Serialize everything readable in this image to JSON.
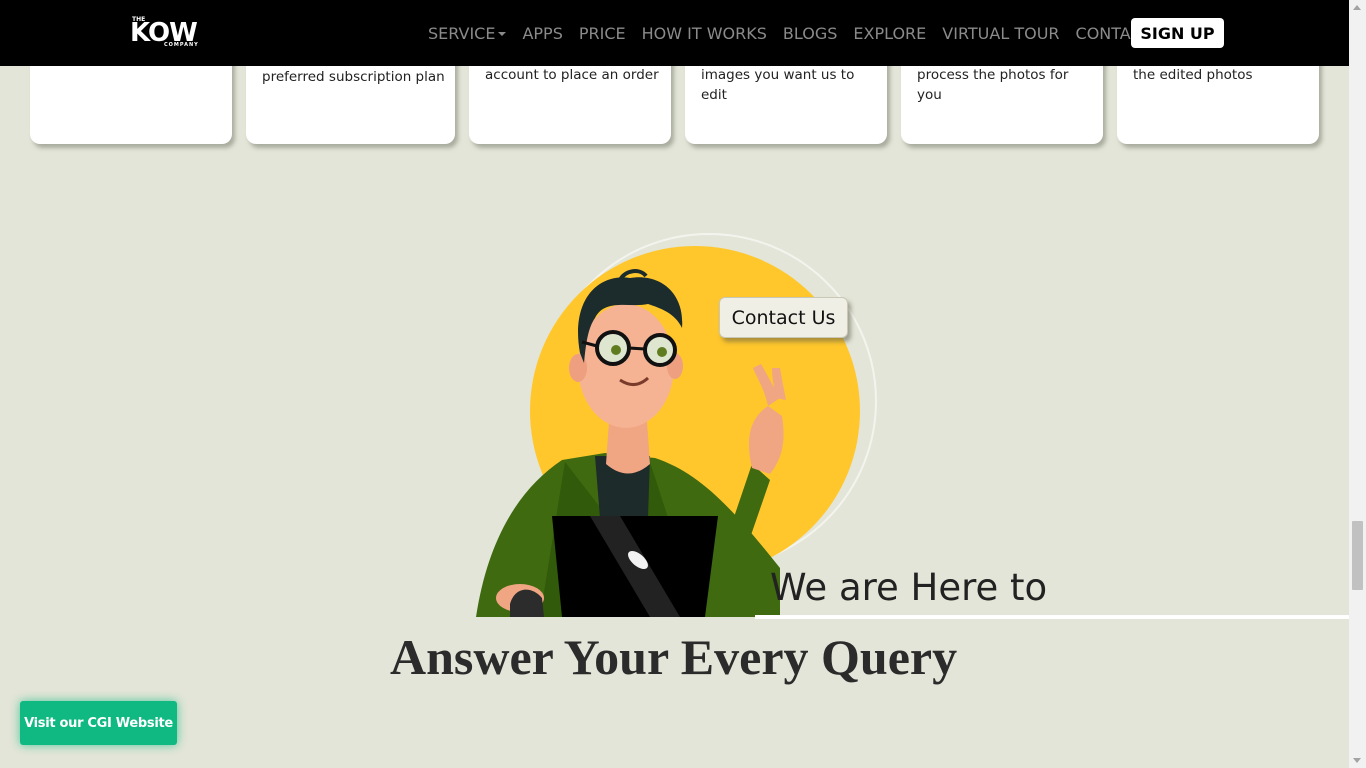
{
  "navbar": {
    "logo": {
      "the": "THE",
      "name": "KOW",
      "company": "COMPANY"
    },
    "links": [
      {
        "label": "SERVICE"
      },
      {
        "label": "APPS"
      },
      {
        "label": "PRICE"
      },
      {
        "label": "HOW IT WORKS"
      },
      {
        "label": "BLOGS"
      },
      {
        "label": "EXPLORE"
      },
      {
        "label": "VIRTUAL TOUR"
      },
      {
        "label": "CONTACT"
      }
    ],
    "signup_label": "SIGN UP"
  },
  "steps": [
    {
      "text": ""
    },
    {
      "text": "preferred subscription plan"
    },
    {
      "text": "account to place an order"
    },
    {
      "text": "images you want us to edit"
    },
    {
      "text": "process the photos for you"
    },
    {
      "text": "the edited photos"
    }
  ],
  "hero": {
    "contact_label": "Contact Us",
    "tagline": "We are Here to",
    "headline": "Answer Your Every Query"
  },
  "floating": {
    "cgi_label": "Visit our CGI Website"
  },
  "colors": {
    "accent": "#ffc72c",
    "cgi_button": "#10b981",
    "nav_bg": "#000000",
    "page_bg": "#e3e5d8"
  }
}
